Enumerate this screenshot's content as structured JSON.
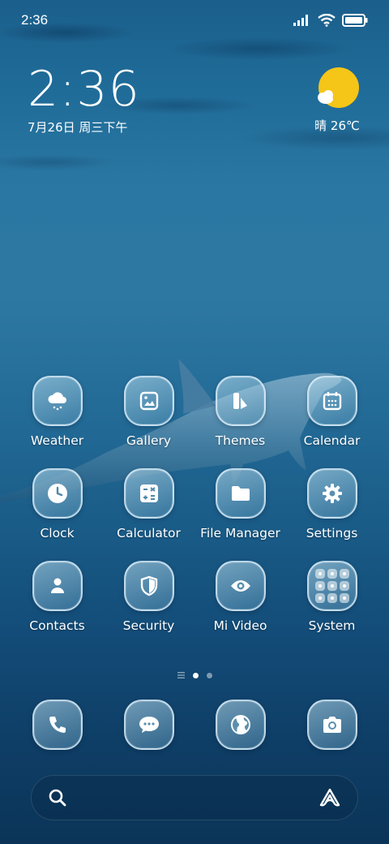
{
  "status_bar": {
    "time": "2:36",
    "icons": [
      "signal-icon",
      "wifi-icon",
      "battery-icon"
    ]
  },
  "clock_widget": {
    "time": "2:36",
    "date": "7月26日 周三下午"
  },
  "weather_widget": {
    "icon": "sun-cloud-icon",
    "temperature": "晴 26℃"
  },
  "apps": [
    {
      "label": "Weather",
      "icon": "cloud-rain-icon"
    },
    {
      "label": "Gallery",
      "icon": "image-icon"
    },
    {
      "label": "Themes",
      "icon": "theme-brush-icon"
    },
    {
      "label": "Calendar",
      "icon": "calendar-icon"
    },
    {
      "label": "Clock",
      "icon": "clock-icon"
    },
    {
      "label": "Calculator",
      "icon": "calculator-icon"
    },
    {
      "label": "File Manager",
      "icon": "folder-icon"
    },
    {
      "label": "Settings",
      "icon": "gear-icon"
    },
    {
      "label": "Contacts",
      "icon": "person-icon"
    },
    {
      "label": "Security",
      "icon": "shield-icon"
    },
    {
      "label": "Mi Video",
      "icon": "eye-icon"
    },
    {
      "label": "System",
      "icon": "folder-grid-icon"
    }
  ],
  "page_indicator": {
    "pages": 2,
    "active": 1
  },
  "dock": [
    {
      "icon": "phone-icon"
    },
    {
      "icon": "message-icon"
    },
    {
      "icon": "globe-icon"
    },
    {
      "icon": "camera-icon"
    }
  ],
  "search_bar": {
    "left_icon": "search-icon",
    "right_icon": "assistant-icon"
  },
  "colors": {
    "accent_sun": "#f5c518",
    "background": "#1f6b98"
  }
}
